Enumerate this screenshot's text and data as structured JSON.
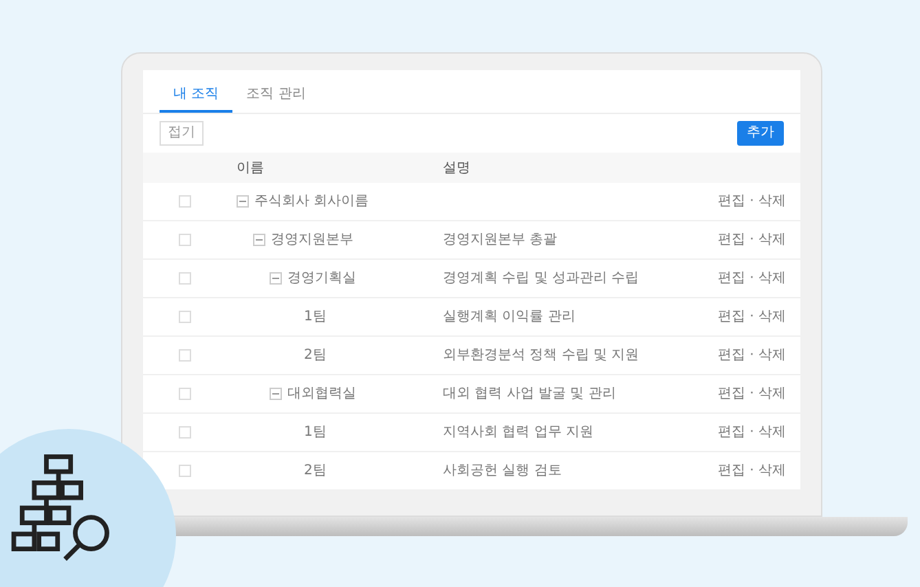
{
  "tabs": [
    {
      "label": "내 조직",
      "selected": true
    },
    {
      "label": "조직 관리",
      "selected": false
    }
  ],
  "toolbar": {
    "collapse_button": "접기",
    "add_button": "추가"
  },
  "table": {
    "columns": [
      "이름",
      "설명"
    ],
    "rows": [
      {
        "name": "주식회사 회사이름",
        "description": "",
        "actions": "편집 · 삭제",
        "checked": false,
        "expanded": true,
        "children": [
          {
            "name": "경영지원본부",
            "description": "경영지원본부 총괄",
            "actions": "편집 · 삭제",
            "checked": false,
            "expanded": true,
            "children": [
              {
                "name": "경영기획실",
                "description": "경영계획 수립 및 성과관리 수립",
                "actions": "편집 · 삭제",
                "checked": false,
                "expanded": true,
                "children": [
                  {
                    "name": "1팀",
                    "description": "실행계획 이익률 관리",
                    "actions": "편집 · 삭제",
                    "checked": false
                  },
                  {
                    "name": "2팀",
                    "description": "외부환경분석 정책 수립 및 지원",
                    "actions": "편집 · 삭제",
                    "checked": false
                  }
                ]
              },
              {
                "name": "대외협력실",
                "description": "대외 협력 사업 발굴 및 관리",
                "actions": "편집 · 삭제",
                "checked": false,
                "expanded": true,
                "children": [
                  {
                    "name": "1팀",
                    "description": "지역사회 협력 업무 지원",
                    "actions": "편집 · 삭제",
                    "checked": false
                  },
                  {
                    "name": "2팀",
                    "description": "사회공헌 실행 검토",
                    "actions": "편집 · 삭제",
                    "checked": false
                  }
                ]
              }
            ]
          }
        ]
      }
    ]
  }
}
